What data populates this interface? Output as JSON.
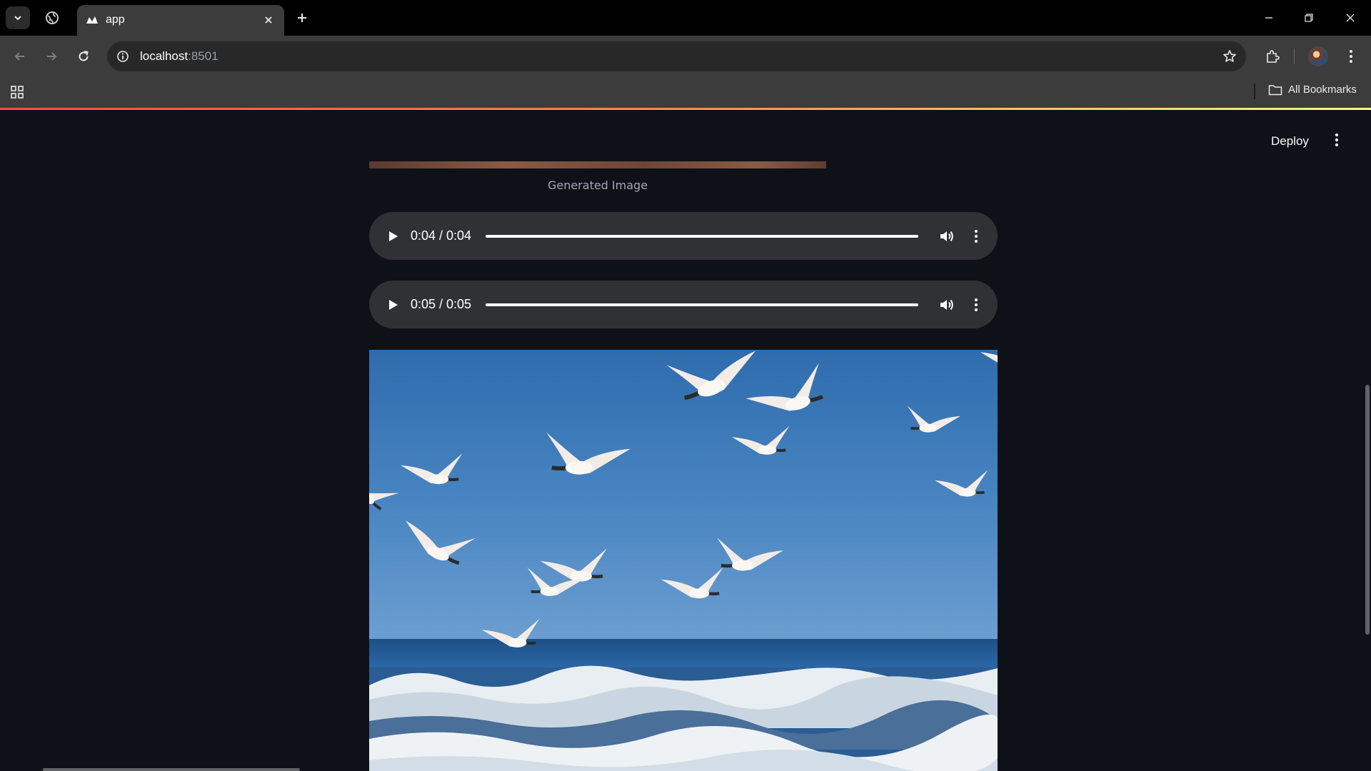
{
  "browser": {
    "tab_title": "app",
    "url_host": "localhost",
    "url_port": ":8501",
    "bookmarks_label": "All Bookmarks",
    "colors": {
      "tabstrip": "#000000",
      "toolbar": "#3c3c3c",
      "accent_gradient": [
        "#ff4b4b",
        "#fffd80"
      ]
    }
  },
  "app": {
    "deploy_label": "Deploy",
    "image_caption": "Generated Image",
    "audio_players": [
      {
        "time": "0:04 / 0:04",
        "progress": 1.0
      },
      {
        "time": "0:05 / 0:05",
        "progress": 1.0
      }
    ],
    "generated_image": {
      "subject": "seagulls flying over ocean waves"
    },
    "colors": {
      "background": "#0e1117",
      "player": "#303134"
    }
  }
}
